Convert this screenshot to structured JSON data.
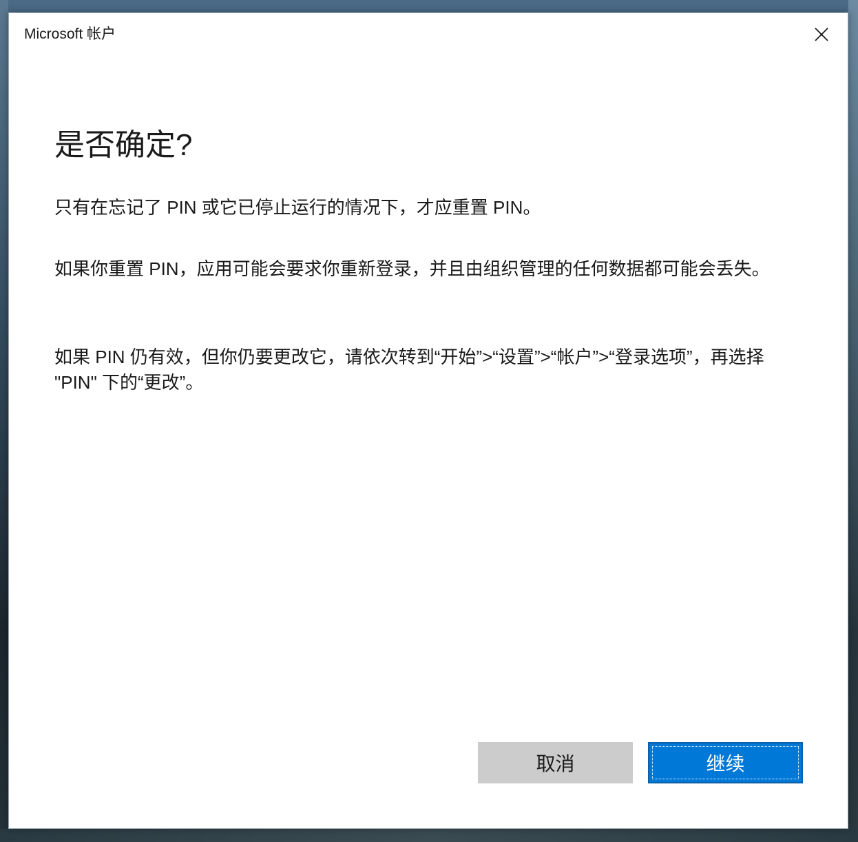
{
  "window": {
    "title": "Microsoft 帐户"
  },
  "dialog": {
    "heading": "是否确定?",
    "paragraphs": [
      "只有在忘记了 PIN 或它已停止运行的情况下，才应重置 PIN。",
      "如果你重置 PIN，应用可能会要求你重新登录，并且由组织管理的任何数据都可能会丢失。",
      "如果 PIN 仍有效，但你仍要更改它，请依次转到“开始”>“设置”>“帐户”>“登录选项”，再选择 \"PIN\" 下的“更改”。"
    ]
  },
  "buttons": {
    "cancel_label": "取消",
    "continue_label": "继续"
  },
  "icons": {
    "close": "close-icon"
  },
  "colors": {
    "accent": "#0078d7",
    "secondary_button": "#cccccc"
  }
}
